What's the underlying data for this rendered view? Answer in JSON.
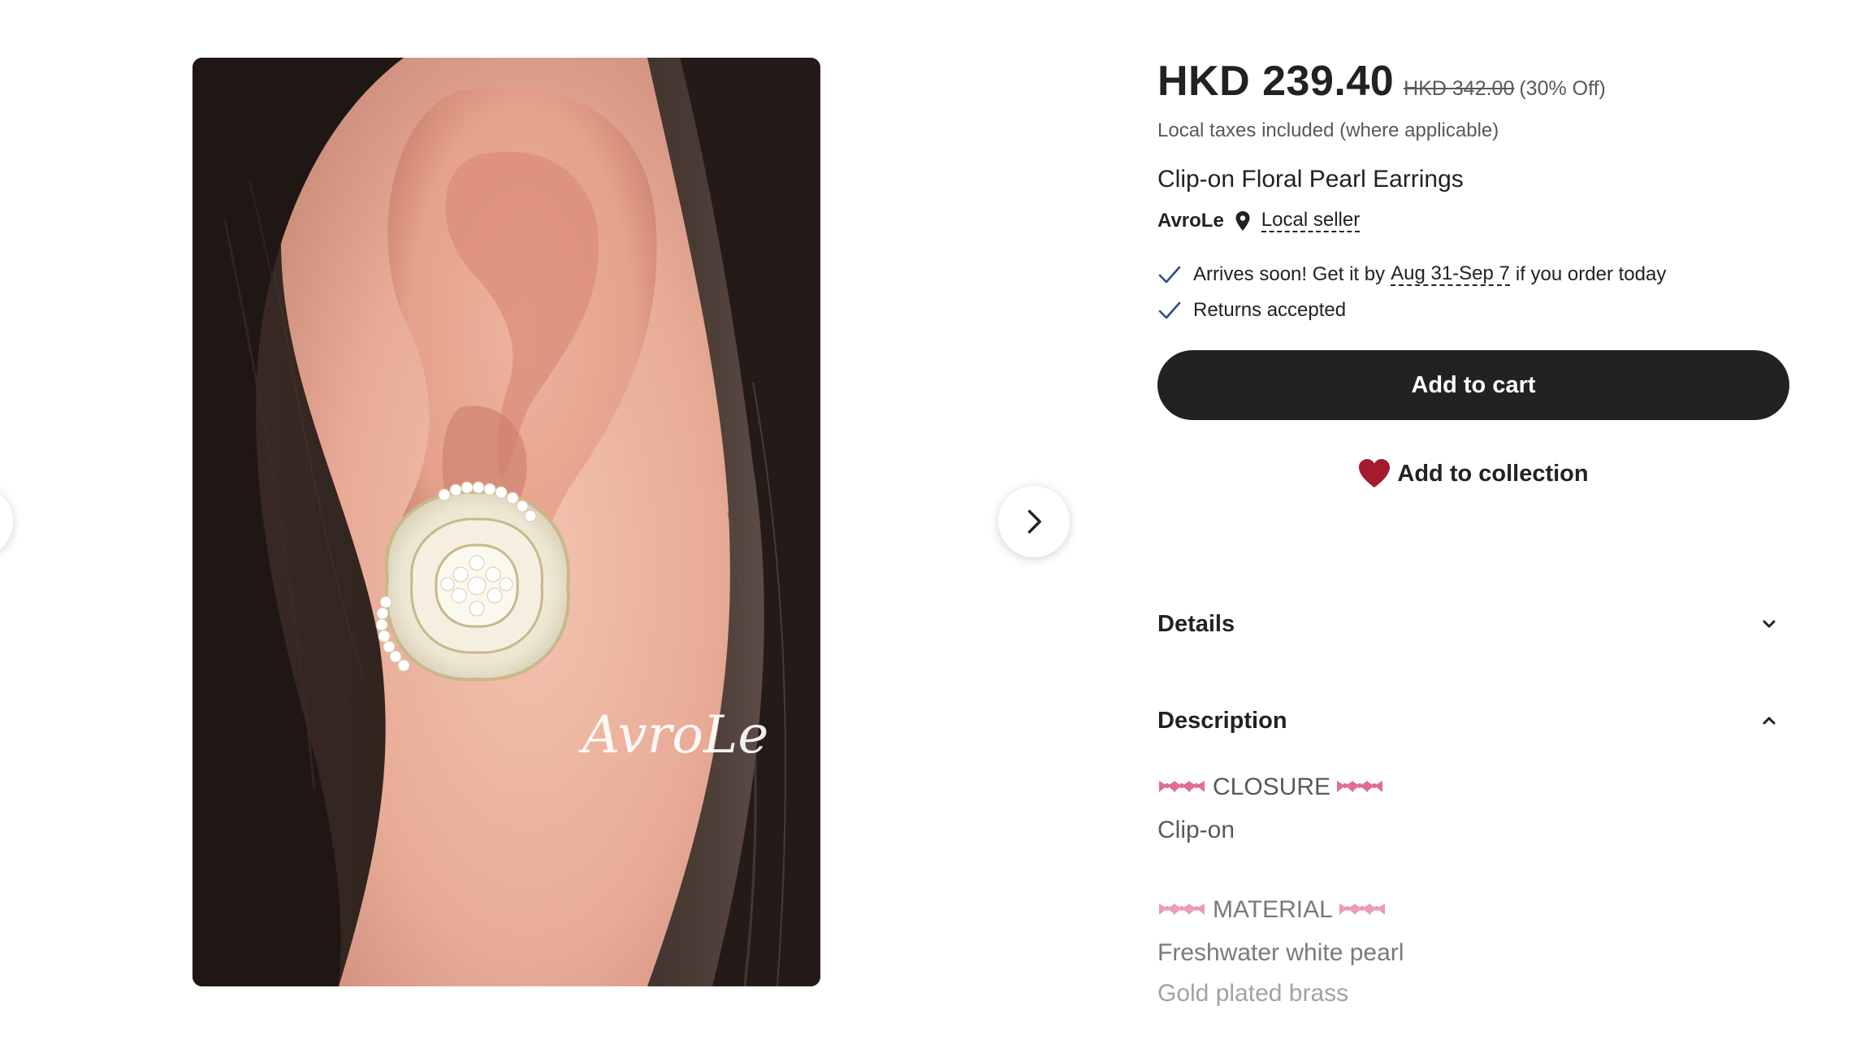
{
  "gallery": {
    "image_alt": "Clip-on Floral Pearl Earrings worn on ear",
    "watermark": "AvroLe"
  },
  "listing": {
    "price": "HKD 239.40",
    "original_price": "HKD 342.00",
    "discount": "(30% Off)",
    "taxes_note": "Local taxes included (where applicable)",
    "title": "Clip-on Floral Pearl Earrings",
    "shop_name": "AvroLe",
    "local_seller_label": "Local seller"
  },
  "perks": {
    "delivery_prefix": "Arrives soon! Get it by",
    "delivery_dates": "Aug 31-Sep 7",
    "delivery_suffix": "if you order today",
    "returns": "Returns accepted"
  },
  "actions": {
    "add_to_cart": "Add to cart",
    "add_to_collection": "Add to collection"
  },
  "accordions": {
    "details": "Details",
    "description": "Description"
  },
  "description": {
    "closure_heading": "CLOSURE",
    "closure_value": "Clip-on",
    "material_heading": "MATERIAL",
    "material_1": "Freshwater white pearl",
    "material_2": "Gold plated brass"
  },
  "icons": {
    "carousel_prev": "chevron-left-icon",
    "carousel_next": "chevron-right-icon",
    "location": "map-pin-icon",
    "check": "check-icon",
    "heart": "heart-icon",
    "chevron_down": "chevron-down-icon",
    "chevron_up": "chevron-up-icon",
    "bow": "ribbon-bow-emoji"
  },
  "colors": {
    "button_bg": "#222222",
    "heart": "#a61a2e",
    "check": "#2f4b8a",
    "bow": "#e06c9a"
  }
}
